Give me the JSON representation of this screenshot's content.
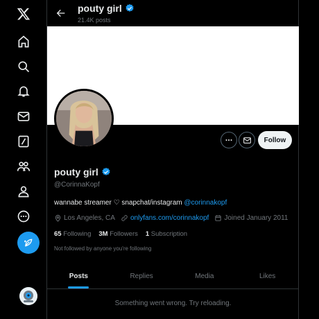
{
  "colors": {
    "accent": "#1d9bf0",
    "background": "#000000",
    "muted": "#71767b",
    "banner": "#ffffff"
  },
  "nav": {
    "icons": [
      "x-logo-icon",
      "home-icon",
      "search-icon",
      "notifications-icon",
      "messages-icon",
      "grok-icon",
      "communities-icon",
      "profile-icon",
      "more-icon"
    ],
    "post_icon": "feather-icon"
  },
  "header": {
    "name": "pouty girl",
    "posts_count": "21.4K posts"
  },
  "profile": {
    "name": "pouty girl",
    "handle": "@CorinnaKopf",
    "bio_text": "wannabe streamer ♡ snapchat/instagram ",
    "bio_mention": "@corinnakopf",
    "location": "Los Angeles, CA",
    "website": "onlyfans.com/corinnakopf",
    "joined": "Joined January 2011",
    "following_count": "65",
    "following_label": "Following",
    "followers_count": "3M",
    "followers_label": "Followers",
    "subscription_count": "1",
    "subscription_label": "Subscription",
    "not_followed": "Not followed by anyone you're following"
  },
  "actions": {
    "follow_label": "Follow"
  },
  "tabs": [
    {
      "label": "Posts",
      "active": true
    },
    {
      "label": "Replies",
      "active": false
    },
    {
      "label": "Media",
      "active": false
    },
    {
      "label": "Likes",
      "active": false
    }
  ],
  "error_message": "Something went wrong. Try reloading."
}
